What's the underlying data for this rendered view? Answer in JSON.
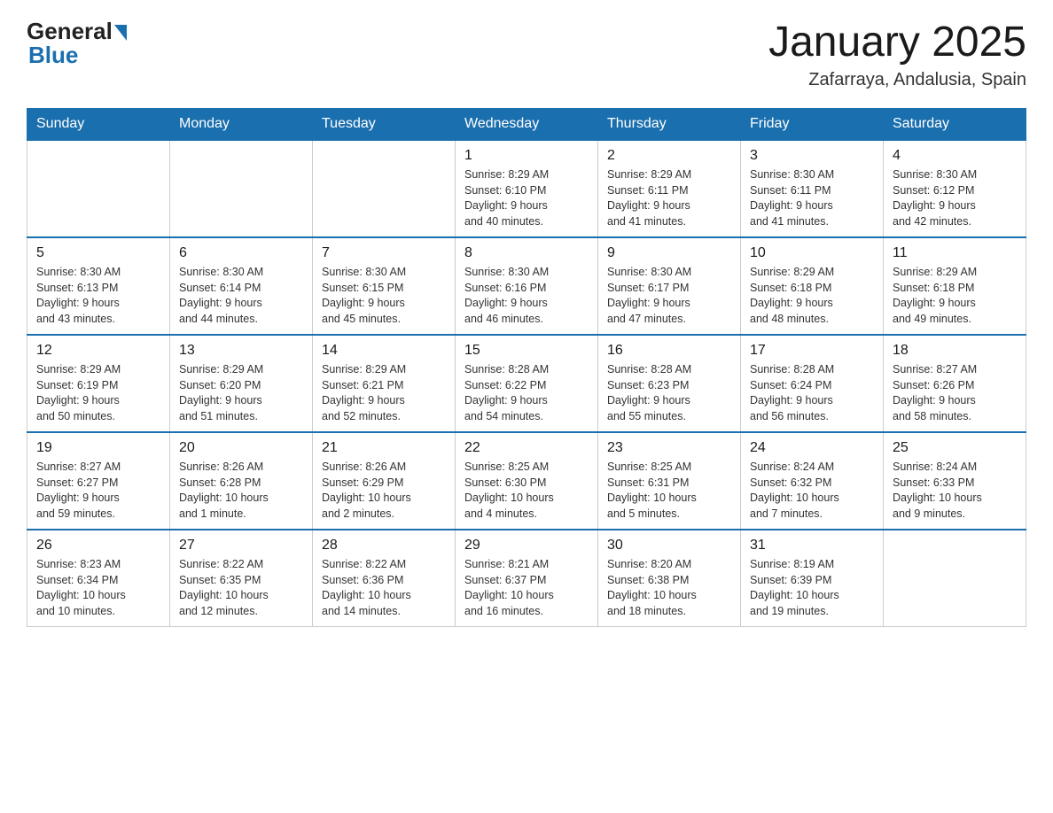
{
  "header": {
    "logo_general": "General",
    "logo_blue": "Blue",
    "title": "January 2025",
    "subtitle": "Zafarraya, Andalusia, Spain"
  },
  "days_of_week": [
    "Sunday",
    "Monday",
    "Tuesday",
    "Wednesday",
    "Thursday",
    "Friday",
    "Saturday"
  ],
  "weeks": [
    [
      {
        "day": "",
        "info": ""
      },
      {
        "day": "",
        "info": ""
      },
      {
        "day": "",
        "info": ""
      },
      {
        "day": "1",
        "info": "Sunrise: 8:29 AM\nSunset: 6:10 PM\nDaylight: 9 hours\nand 40 minutes."
      },
      {
        "day": "2",
        "info": "Sunrise: 8:29 AM\nSunset: 6:11 PM\nDaylight: 9 hours\nand 41 minutes."
      },
      {
        "day": "3",
        "info": "Sunrise: 8:30 AM\nSunset: 6:11 PM\nDaylight: 9 hours\nand 41 minutes."
      },
      {
        "day": "4",
        "info": "Sunrise: 8:30 AM\nSunset: 6:12 PM\nDaylight: 9 hours\nand 42 minutes."
      }
    ],
    [
      {
        "day": "5",
        "info": "Sunrise: 8:30 AM\nSunset: 6:13 PM\nDaylight: 9 hours\nand 43 minutes."
      },
      {
        "day": "6",
        "info": "Sunrise: 8:30 AM\nSunset: 6:14 PM\nDaylight: 9 hours\nand 44 minutes."
      },
      {
        "day": "7",
        "info": "Sunrise: 8:30 AM\nSunset: 6:15 PM\nDaylight: 9 hours\nand 45 minutes."
      },
      {
        "day": "8",
        "info": "Sunrise: 8:30 AM\nSunset: 6:16 PM\nDaylight: 9 hours\nand 46 minutes."
      },
      {
        "day": "9",
        "info": "Sunrise: 8:30 AM\nSunset: 6:17 PM\nDaylight: 9 hours\nand 47 minutes."
      },
      {
        "day": "10",
        "info": "Sunrise: 8:29 AM\nSunset: 6:18 PM\nDaylight: 9 hours\nand 48 minutes."
      },
      {
        "day": "11",
        "info": "Sunrise: 8:29 AM\nSunset: 6:18 PM\nDaylight: 9 hours\nand 49 minutes."
      }
    ],
    [
      {
        "day": "12",
        "info": "Sunrise: 8:29 AM\nSunset: 6:19 PM\nDaylight: 9 hours\nand 50 minutes."
      },
      {
        "day": "13",
        "info": "Sunrise: 8:29 AM\nSunset: 6:20 PM\nDaylight: 9 hours\nand 51 minutes."
      },
      {
        "day": "14",
        "info": "Sunrise: 8:29 AM\nSunset: 6:21 PM\nDaylight: 9 hours\nand 52 minutes."
      },
      {
        "day": "15",
        "info": "Sunrise: 8:28 AM\nSunset: 6:22 PM\nDaylight: 9 hours\nand 54 minutes."
      },
      {
        "day": "16",
        "info": "Sunrise: 8:28 AM\nSunset: 6:23 PM\nDaylight: 9 hours\nand 55 minutes."
      },
      {
        "day": "17",
        "info": "Sunrise: 8:28 AM\nSunset: 6:24 PM\nDaylight: 9 hours\nand 56 minutes."
      },
      {
        "day": "18",
        "info": "Sunrise: 8:27 AM\nSunset: 6:26 PM\nDaylight: 9 hours\nand 58 minutes."
      }
    ],
    [
      {
        "day": "19",
        "info": "Sunrise: 8:27 AM\nSunset: 6:27 PM\nDaylight: 9 hours\nand 59 minutes."
      },
      {
        "day": "20",
        "info": "Sunrise: 8:26 AM\nSunset: 6:28 PM\nDaylight: 10 hours\nand 1 minute."
      },
      {
        "day": "21",
        "info": "Sunrise: 8:26 AM\nSunset: 6:29 PM\nDaylight: 10 hours\nand 2 minutes."
      },
      {
        "day": "22",
        "info": "Sunrise: 8:25 AM\nSunset: 6:30 PM\nDaylight: 10 hours\nand 4 minutes."
      },
      {
        "day": "23",
        "info": "Sunrise: 8:25 AM\nSunset: 6:31 PM\nDaylight: 10 hours\nand 5 minutes."
      },
      {
        "day": "24",
        "info": "Sunrise: 8:24 AM\nSunset: 6:32 PM\nDaylight: 10 hours\nand 7 minutes."
      },
      {
        "day": "25",
        "info": "Sunrise: 8:24 AM\nSunset: 6:33 PM\nDaylight: 10 hours\nand 9 minutes."
      }
    ],
    [
      {
        "day": "26",
        "info": "Sunrise: 8:23 AM\nSunset: 6:34 PM\nDaylight: 10 hours\nand 10 minutes."
      },
      {
        "day": "27",
        "info": "Sunrise: 8:22 AM\nSunset: 6:35 PM\nDaylight: 10 hours\nand 12 minutes."
      },
      {
        "day": "28",
        "info": "Sunrise: 8:22 AM\nSunset: 6:36 PM\nDaylight: 10 hours\nand 14 minutes."
      },
      {
        "day": "29",
        "info": "Sunrise: 8:21 AM\nSunset: 6:37 PM\nDaylight: 10 hours\nand 16 minutes."
      },
      {
        "day": "30",
        "info": "Sunrise: 8:20 AM\nSunset: 6:38 PM\nDaylight: 10 hours\nand 18 minutes."
      },
      {
        "day": "31",
        "info": "Sunrise: 8:19 AM\nSunset: 6:39 PM\nDaylight: 10 hours\nand 19 minutes."
      },
      {
        "day": "",
        "info": ""
      }
    ]
  ]
}
